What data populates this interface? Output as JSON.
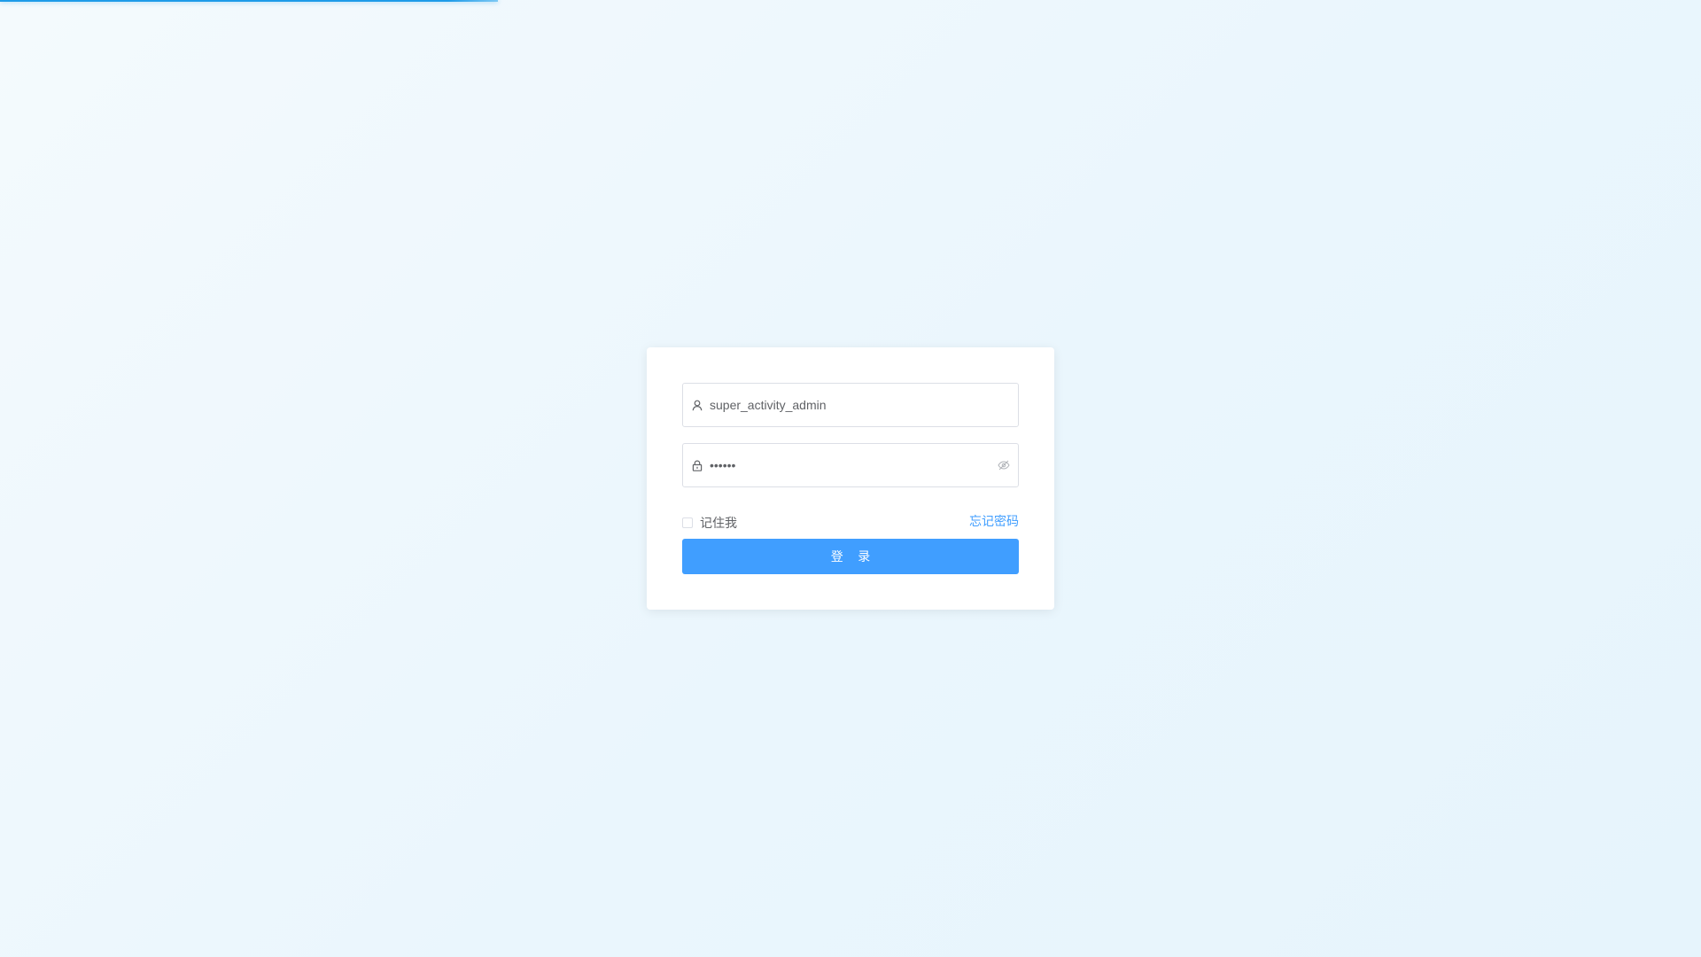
{
  "page": {
    "loading_progress": 0.239
  },
  "login": {
    "username": {
      "value": "super_activity_admin",
      "icon": "user-icon"
    },
    "password": {
      "value": "••••••",
      "icon": "lock-icon",
      "toggle_icon": "eye-off-icon"
    },
    "remember_label": "记住我",
    "remember_checked": false,
    "forgot_label": "忘记密码",
    "submit_label": "登 录"
  },
  "colors": {
    "primary": "#409eff",
    "progress": "#1e9be8",
    "border": "#dcdfe6",
    "text": "#606266"
  }
}
